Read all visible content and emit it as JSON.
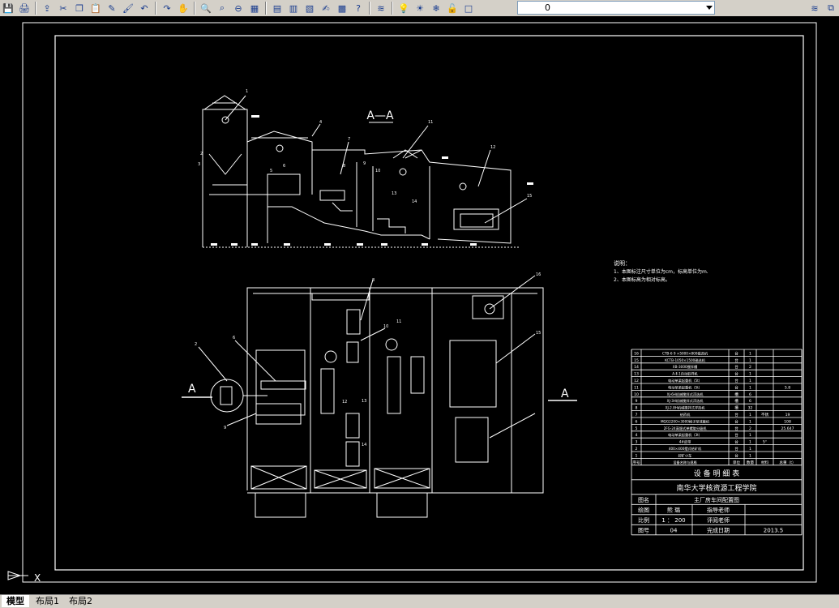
{
  "toolbar": {
    "icons": [
      "save-icon",
      "print-icon",
      "publish-icon",
      "cut-icon",
      "copy-icon",
      "paste-icon",
      "match-properties-icon",
      "brush-icon",
      "undo-icon",
      "redo-icon",
      "pan-icon",
      "zoom-realtime-icon",
      "zoom-window-icon",
      "zoom-previous-icon",
      "properties-icon",
      "design-center-icon",
      "tool-palettes-icon",
      "sheetset-icon",
      "markup-icon",
      "calculator-icon",
      "help-icon",
      "layer-manager-icon",
      "bulb-icon",
      "sun-icon",
      "freeze-icon",
      "lock-icon",
      "color-square-icon"
    ],
    "layer_value": "0"
  },
  "drawing": {
    "section_title": "A—A",
    "section_mark_left": "A",
    "section_mark_right": "A",
    "notes_heading": "说明：",
    "notes": [
      "1、本图标注尺寸单位为cm，标高单位为m.",
      "2、本图标高为相对标高。"
    ],
    "equipment_rows": [
      [
        "16",
        "CTB-6 9 ×5000×800磁选机",
        "台",
        "1",
        "",
        ""
      ],
      [
        "15",
        "KCTB-1050×1500磁选机",
        "台",
        "1",
        "",
        ""
      ],
      [
        "14",
        "XB-3000搅拌槽",
        "台",
        "2",
        "",
        ""
      ],
      [
        "13",
        "A-Ⅱ-1自动取样机",
        "台",
        "1",
        "",
        ""
      ],
      [
        "12",
        "电动单梁起重机（5t）",
        "台",
        "1",
        "",
        ""
      ],
      [
        "11",
        "电动单梁起重机（5t）",
        "台",
        "1",
        "",
        "5.8"
      ],
      [
        "10",
        "XJ-6H机械搅拌式浮选机",
        "槽",
        "6",
        "",
        ""
      ],
      [
        "9",
        "XJ-3H机械搅拌式浮选机",
        "槽",
        "6",
        "",
        ""
      ],
      [
        "8",
        "XJ-2.8H机械搅拌式浮选机",
        "槽",
        "32",
        "",
        ""
      ],
      [
        "7",
        "给药机",
        "台",
        "1",
        "不锈",
        "19"
      ],
      [
        "6",
        "MQG2200×3000格子型球磨机",
        "台",
        "1",
        "",
        "108"
      ],
      [
        "5",
        "2FG-24高堰式单螺旋分级机",
        "台",
        "2",
        "",
        "25.647"
      ],
      [
        "4",
        "电动单梁起重机（3t）",
        "台",
        "1",
        "",
        ""
      ],
      [
        "3",
        "4#皮带",
        "台",
        "1",
        "5°",
        ""
      ],
      [
        "2",
        "400×400摆式给矿机",
        "台",
        "1",
        "",
        ""
      ],
      [
        "1",
        "卸矿小车",
        "台",
        "1",
        "",
        ""
      ]
    ],
    "table_header": [
      "序号",
      "设备名称与规格",
      "单位",
      "数量",
      "材料",
      "总重（t）"
    ],
    "table_title": "设 备 明 细 表",
    "school": "南华大学核资源工程学院",
    "title_block": {
      "drawing_name_label": "图名",
      "drawing_name": "主厂房车间配置图",
      "drawn_label": "绘图",
      "drawn_value": "熊 璐",
      "advisor_label": "指导老师",
      "scale_label": "比例",
      "scale_value": "1 ： 200",
      "reviewer_label": "评阅老师",
      "number_label": "图号",
      "number_value": "04",
      "date_label": "完成日期",
      "date_value": "2013.5"
    },
    "callouts_top": [
      "1",
      "2",
      "3",
      "4",
      "5",
      "6",
      "7",
      "8",
      "9",
      "10",
      "11",
      "12",
      "13",
      "14",
      "15"
    ],
    "callouts_plan": [
      "2",
      "6",
      "8",
      "9",
      "10",
      "11",
      "12",
      "13",
      "14",
      "15",
      "16"
    ]
  },
  "tabs": {
    "items": [
      "模型",
      "布局1",
      "布局2"
    ],
    "active": "模型"
  }
}
